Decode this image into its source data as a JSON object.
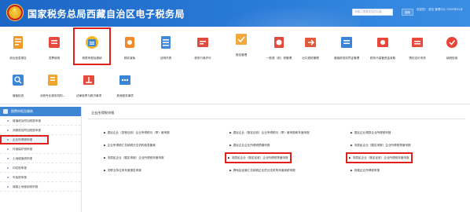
{
  "header": {
    "title": "国家税务总局西藏自治区电子税务局",
    "search_placeholder": "请输入需要查找的功能",
    "search_button": "搜索",
    "user_info": "欢迎您！ 退出 管理中心 2020年01月"
  },
  "icons": [
    {
      "label": "综合信息报告",
      "icon": "document-icon"
    },
    {
      "label": "发票使用",
      "icon": "invoice-icon"
    },
    {
      "label": "税费申报及缴纳",
      "icon": "tax-return-icon"
    },
    {
      "label": "税收减免",
      "icon": "tax-relief-icon"
    },
    {
      "label": "证明开具",
      "icon": "certificate-icon"
    },
    {
      "label": "税务行政许可",
      "icon": "license-icon"
    },
    {
      "label": "核定管理",
      "icon": "approval-icon"
    },
    {
      "label": "一般退（抵）税管理",
      "icon": "refund-icon"
    },
    {
      "label": "出口退税管理",
      "icon": "export-icon"
    },
    {
      "label": "增值税抵扣凭证管理",
      "icon": "voucher-icon"
    },
    {
      "label": "税务代保管资金收取",
      "icon": "fund-icon"
    },
    {
      "label": "预约定价安排",
      "icon": "pricing-icon"
    },
    {
      "label": "纳税信用",
      "icon": "credit-icon"
    },
    {
      "label": "增值检查",
      "icon": "inspection-icon"
    },
    {
      "label": "涉税专业服务机构...",
      "icon": "agency-icon"
    },
    {
      "label": "法律追责与救济事项",
      "icon": "legal-icon"
    },
    {
      "label": "其他服务事项",
      "icon": "other-services-icon"
    }
  ],
  "sidebar": {
    "header": "税费申报及缴纳",
    "items": [
      {
        "label": "增值税及附加税费申报"
      },
      {
        "label": "消费税及附加税费申报"
      },
      {
        "label": "企业所得税申报"
      },
      {
        "label": "环境保护税申报"
      },
      {
        "label": "土地增值税申报"
      },
      {
        "label": "印花税申报"
      },
      {
        "label": "车船税申报"
      },
      {
        "label": "城镇土地使用税申报"
      }
    ]
  },
  "main": {
    "title": "企业所得税申报",
    "links": [
      {
        "label": "居民企业（查账征收）企业所得税月（季）度申报"
      },
      {
        "label": "居民企业（核定征收）企业所得税月（季）度申报和年度申报"
      },
      {
        "label": "居民企业清算企业所得税申报"
      },
      {
        "label": "企业所得税汇总纳税分支机构信息备案"
      },
      {
        "label": "居民企业企业所得税预缴申报"
      },
      {
        "label": "非居民企业（据实申报）企业所得税季度申报"
      },
      {
        "label": "非居民企业（据实申报）企业所得税年度申报"
      },
      {
        "label": "非居民企业（核定征收）企业所得税季度申报"
      },
      {
        "label": "非居民企业（核定征收）企业所得税年度申报"
      },
      {
        "label": "关联业务往来年度报告申报"
      },
      {
        "label": "跨地区经营汇总纳税企业的分支机构年度纳税申报"
      },
      {
        "label": "扣缴企业所得税申报"
      }
    ]
  },
  "colors": {
    "header_blue": "#2a7bd8",
    "highlight_red": "#e0201a",
    "sidebar_header": "#3e86d4"
  }
}
